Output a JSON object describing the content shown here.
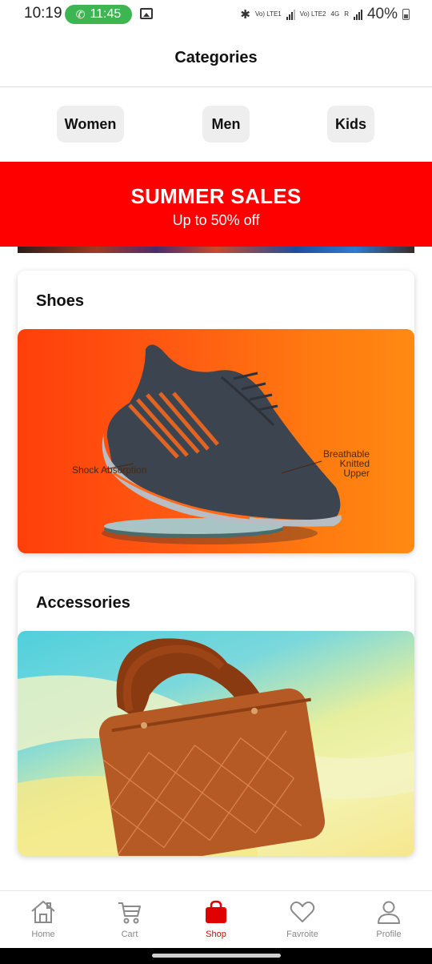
{
  "status_bar": {
    "time": "10:19",
    "call_time": "11:45",
    "network_1": "Vo) LTE1",
    "network_2": "Vo) LTE2",
    "network_type": "4G",
    "roaming": "R",
    "battery": "40%"
  },
  "header": {
    "title": "Categories"
  },
  "category_chips": [
    {
      "label": "Women"
    },
    {
      "label": "Men"
    },
    {
      "label": "Kids"
    }
  ],
  "banner": {
    "title": "SUMMER SALES",
    "subtitle": "Up to 50% off",
    "color": "#ff0000"
  },
  "cards": [
    {
      "title": "Shoes",
      "image_annotations": [
        "Shock Absorption",
        "Breathable Knitted Upper"
      ]
    },
    {
      "title": "Accessories"
    }
  ],
  "bottom_nav": {
    "items": [
      {
        "label": "Home",
        "icon": "home-icon"
      },
      {
        "label": "Cart",
        "icon": "cart-icon"
      },
      {
        "label": "Shop",
        "icon": "shopping-bag-icon"
      },
      {
        "label": "Favroite",
        "icon": "heart-icon"
      },
      {
        "label": "Profile",
        "icon": "user-icon"
      }
    ],
    "active": "Shop",
    "active_color": "#e10000",
    "inactive_color": "#888888"
  }
}
